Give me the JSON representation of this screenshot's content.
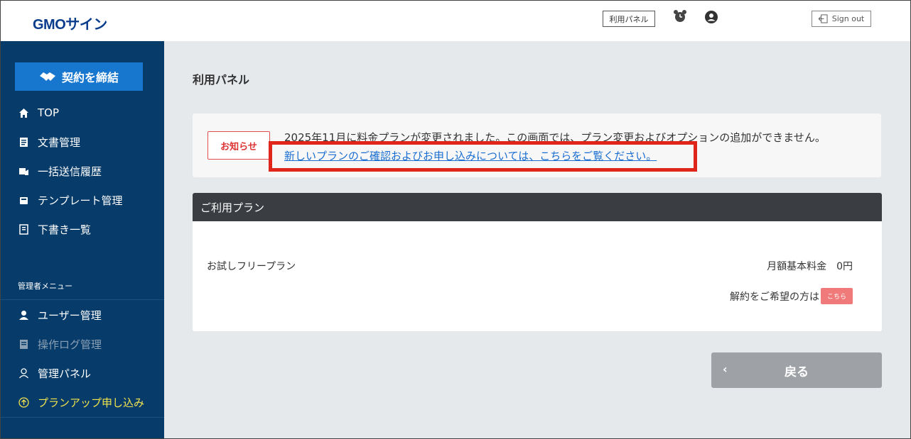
{
  "header": {
    "logo": "GMOサイン",
    "panel_button": "利用パネル",
    "signout_label": "Sign out"
  },
  "sidebar": {
    "contract_button": "契約を締結",
    "items": [
      {
        "label": "TOP",
        "icon": "home-icon"
      },
      {
        "label": "文書管理",
        "icon": "document-icon"
      },
      {
        "label": "一括送信履歴",
        "icon": "bulk-send-icon"
      },
      {
        "label": "テンプレート管理",
        "icon": "template-icon"
      },
      {
        "label": "下書き一覧",
        "icon": "draft-icon"
      }
    ],
    "admin_label": "管理者メニュー",
    "admin_items": [
      {
        "label": "ユーザー管理",
        "icon": "user-icon"
      },
      {
        "label": "操作ログ管理",
        "icon": "log-icon"
      },
      {
        "label": "管理パネル",
        "icon": "admin-panel-icon"
      },
      {
        "label": "プランアップ申し込み",
        "icon": "upgrade-icon"
      }
    ]
  },
  "main": {
    "title": "利用パネル",
    "notice": {
      "badge": "お知らせ",
      "text": "2025年11月に料金プランが変更されました。この画面では、プラン変更およびオプションの追加ができません。",
      "link": "新しいプランのご確認およびお申し込みについては、こちらをご覧ください。"
    },
    "plan": {
      "header": "ご利用プラン",
      "name": "お試しフリープラン",
      "fee": "月額基本料金　0円",
      "cancel_text": "解約をご希望の方は",
      "cancel_link": "こちら"
    },
    "back_button": "戻る"
  },
  "colors": {
    "sidebar_bg": "#073b69",
    "accent": "#1777cf",
    "highlight": "#e0261b",
    "upgrade": "#f2e44d"
  }
}
